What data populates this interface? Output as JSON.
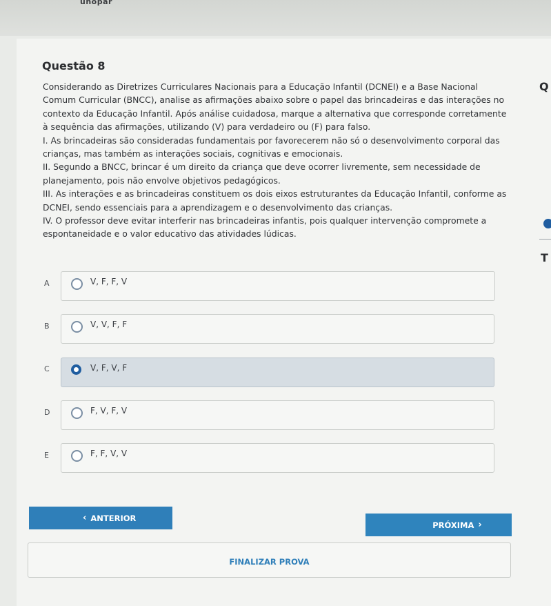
{
  "header": {
    "brand": "unopar"
  },
  "question": {
    "title": "Questão 8",
    "paragraphs": [
      "Considerando as Diretrizes Curriculares Nacionais para a Educação Infantil (DCNEI) e a Base Nacional Comum Curricular (BNCC), analise as afirmações abaixo sobre o papel das brincadeiras e das interações no contexto da Educação Infantil. Após análise cuidadosa, marque a alternativa que corresponde corretamente à sequência das afirmações, utilizando (V) para verdadeiro ou (F) para falso.",
      "I. As brincadeiras são consideradas fundamentais por favorecerem não só o desenvolvimento corporal das crianças, mas também as interações sociais, cognitivas e emocionais.",
      "II. Segundo a BNCC, brincar é um direito da criança que deve ocorrer livremente, sem necessidade de planejamento, pois não envolve objetivos pedagógicos.",
      "III. As interações e as brincadeiras constituem os dois eixos estruturantes da Educação Infantil, conforme as DCNEI, sendo essenciais para a aprendizagem e o desenvolvimento das crianças.",
      "IV. O professor deve evitar interferir nas brincadeiras infantis, pois qualquer intervenção compromete a espontaneidade e o valor educativo das atividades lúdicas."
    ]
  },
  "side": {
    "q_glyph": "Q",
    "t_glyph": "T"
  },
  "options": [
    {
      "letter": "A",
      "text": "V, F, F, V",
      "selected": false
    },
    {
      "letter": "B",
      "text": "V, V, F, F",
      "selected": false
    },
    {
      "letter": "C",
      "text": "V, F, V, F",
      "selected": true
    },
    {
      "letter": "D",
      "text": "F, V, F, V",
      "selected": false
    },
    {
      "letter": "E",
      "text": "F, F, V, V",
      "selected": false
    }
  ],
  "nav": {
    "prev_label": "ANTERIOR",
    "next_label": "PRÓXIMA",
    "finish_label": "FINALIZAR PROVA"
  }
}
